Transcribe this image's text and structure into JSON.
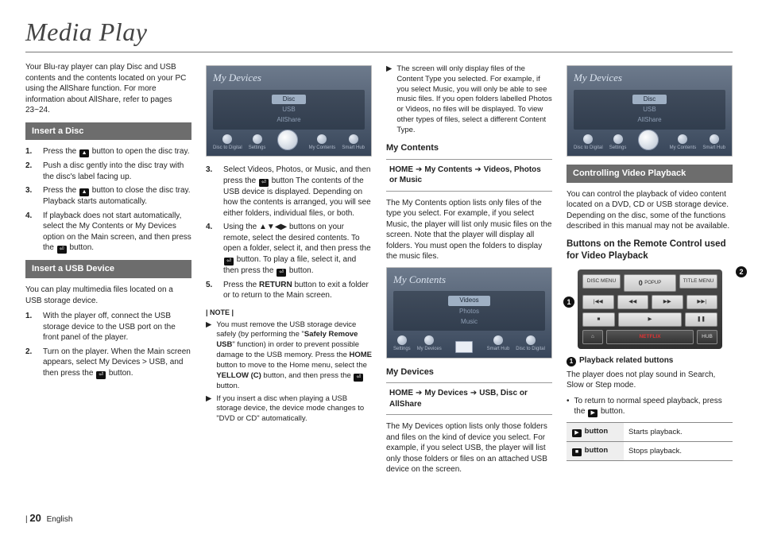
{
  "page": {
    "title": "Media Play",
    "number": "20",
    "language": "English"
  },
  "intro": "Your Blu-ray player can play Disc and USB contents and the contents located on your PC using the AllShare function. For more information about AllShare, refer to pages 23~24.",
  "headings": {
    "insert_disc": "Insert a Disc",
    "insert_usb": "Insert a USB Device",
    "my_contents": "My Contents",
    "my_devices": "My Devices",
    "controlling": "Controlling Video Playback"
  },
  "insert_disc_steps": [
    "Press the – button to open the disc tray.",
    "Push a disc gently into the disc tray with the disc's label facing up.",
    "Press the – button to close the disc tray. Playback starts automatically.",
    "If playback does not start automatically, select the My Contents or My Devices option on the Main screen, and then press the – button."
  ],
  "insert_usb_intro": "You can play multimedia files located on a USB storage device.",
  "insert_usb_steps": [
    "With the player off, connect the USB storage device to the USB port on the front panel of the player.",
    "Turn on the player. When the Main screen appears, select My Devices > USB, and then press the – button."
  ],
  "col2_steps": [
    "Select Videos, Photos, or Music, and then press the – button The contents of the USB device is displayed. Depending on how the contents is arranged, you will see either folders, individual files, or both.",
    "Using the ▲▼◀▶ buttons on your remote, select the desired contents. To open a folder, select it, and then press the – button. To play a file, select it, and then press the – button.",
    "Press the RETURN button to exit a folder or to return to the Main screen."
  ],
  "note_label": "| NOTE |",
  "notes": [
    "You must remove the USB storage device safely (by performing the \"Safely Remove USB\" function) in order to prevent possible damage to the USB memory. Press the HOME button to move to the Home menu, select the YELLOW (C) button, and then press the – button.",
    "If you insert a disc when playing a USB storage device, the device mode changes to \"DVD or CD\" automatically."
  ],
  "col3_top": "The screen will only display files of the Content Type you selected. For example, if you select Music, you will only be able to see music files. If you open folders labelled Photos or Videos, no files will be displayed. To view other types of files, select a different Content Type.",
  "my_contents_path": {
    "parts": [
      "HOME",
      "My Contents",
      "Videos, Photos or Music"
    ]
  },
  "my_contents_text": "The My Contents option lists only files of the type you select. For example, if you select Music, the player will list only music files on the screen. Note that the player will display all folders. You must open the folders to display the music files.",
  "my_devices_path": {
    "parts": [
      "HOME",
      "My Devices",
      "USB, Disc or AllShare"
    ]
  },
  "my_devices_text": "The My Devices option lists only those folders and files on the kind of device you select. For example, if you select USB, the player will list only those folders or files on an attached USB device on the screen.",
  "controlling_intro": "You can control the playback of video content located on a DVD, CD or USB storage device. Depending on the disc, some of the functions described in this manual may not be available.",
  "controlling_sub": "Buttons on the Remote Control used for Video Playback",
  "playback_heading": "Playback related buttons",
  "playback_text": "The player does not play sound in Search, Slow or Step mode.",
  "playback_bullet": "To return to normal speed playback, press the – button.",
  "button_table": [
    {
      "btn": "▶ button",
      "desc": "Starts playback."
    },
    {
      "btn": "■ button",
      "desc": "Stops playback."
    }
  ],
  "screens": {
    "devices": {
      "title": "My Devices",
      "items": [
        "Disc",
        "USB",
        "AllShare"
      ],
      "selected": 0,
      "dock_left": [
        "Disc to Digital",
        "Settings"
      ],
      "dock_right": [
        "My Contents",
        "Smart Hub"
      ]
    },
    "contents": {
      "title": "My Contents",
      "items": [
        "Videos",
        "Photos",
        "Music"
      ],
      "selected": 0,
      "dock_left": [
        "Settings",
        "My Devices"
      ],
      "dock_right": [
        "Smart Hub",
        "Disc to Digital"
      ]
    }
  },
  "remote": {
    "row1": [
      "DISC MENU",
      "",
      "TITLE MENU"
    ],
    "row1_mid": "0",
    "row1_mid_label": "POPUP",
    "row2": [
      "|◀◀",
      "◀◀",
      "▶▶",
      "▶▶|"
    ],
    "row3": [
      "■",
      "▶",
      "❚❚"
    ],
    "row4_left": "⌂",
    "row4_mid": "NETFLIX",
    "row4_right": "HUB"
  }
}
